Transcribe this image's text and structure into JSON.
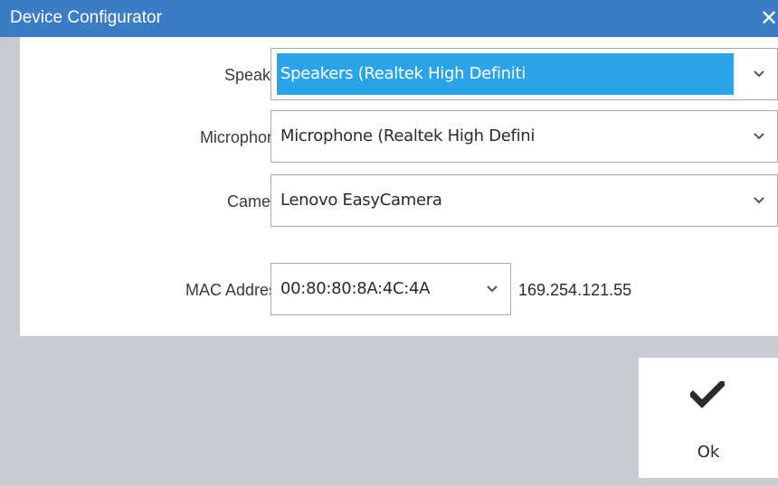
{
  "window": {
    "title": "Device Configurator",
    "close_icon": "close-icon"
  },
  "form": {
    "speaker": {
      "label": "Speaker",
      "value": "Speakers (Realtek High Definiti"
    },
    "microphone": {
      "label": "Microphone",
      "value": "Microphone (Realtek High Defini"
    },
    "camera": {
      "label": "Camera",
      "value": "Lenovo EasyCamera"
    },
    "mac": {
      "label": "MAC Address",
      "value": "00:80:80:8A:4C:4A",
      "ip": "169.254.121.55"
    }
  },
  "actions": {
    "ok_label": "Ok",
    "ok_icon": "checkmark-icon"
  },
  "colors": {
    "titlebar": "#3a7dc5",
    "highlight": "#2aa3e8",
    "background": "#c8ccd0"
  }
}
